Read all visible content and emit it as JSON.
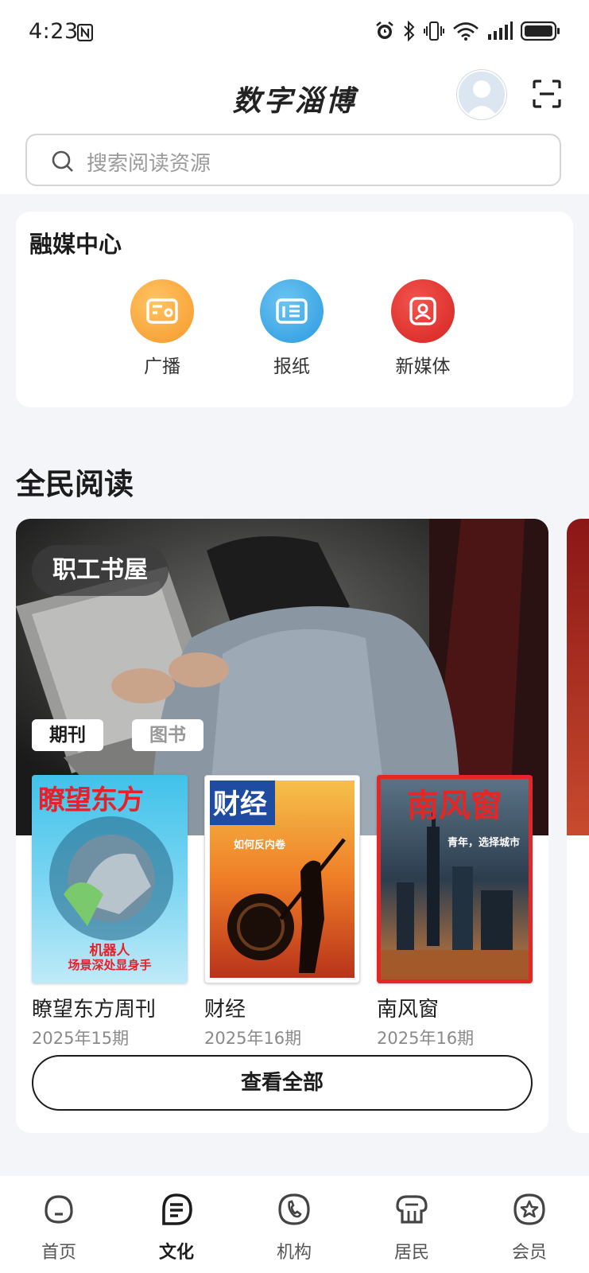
{
  "status_bar": {
    "time": "4:23"
  },
  "header": {
    "app_title": "数字淄博",
    "search_placeholder": "搜索阅读资源"
  },
  "media_center": {
    "title": "融媒中心",
    "items": [
      {
        "label": "广播",
        "icon": "radio-icon",
        "color": "#f9a83a"
      },
      {
        "label": "报纸",
        "icon": "newspaper-icon",
        "color": "#3ea9e8"
      },
      {
        "label": "新媒体",
        "icon": "new-media-icon",
        "color": "#e3342f"
      }
    ]
  },
  "reading": {
    "title": "全民阅读",
    "banner_tag": "职工书屋",
    "tabs": [
      {
        "label": "期刊",
        "active": true
      },
      {
        "label": "图书",
        "active": false
      }
    ],
    "books": [
      {
        "name": "瞭望东方周刊",
        "issue": "2025年15期",
        "cover_title": "瞭望东方",
        "cover_caption_1": "机器人",
        "cover_caption_2": "场景深处显身手"
      },
      {
        "name": "财经",
        "issue": "2025年16期",
        "cover_title": "财经",
        "cover_caption_1": "如何反内卷"
      },
      {
        "name": "南风窗",
        "issue": "2025年16期",
        "cover_title": "南风窗",
        "cover_caption_1": "青年，选择城市"
      }
    ],
    "view_all": "查看全部"
  },
  "tabbar": [
    {
      "label": "首页",
      "icon": "home-icon",
      "active": false
    },
    {
      "label": "文化",
      "icon": "culture-icon",
      "active": true
    },
    {
      "label": "机构",
      "icon": "institution-icon",
      "active": false
    },
    {
      "label": "居民",
      "icon": "resident-icon",
      "active": false
    },
    {
      "label": "会员",
      "icon": "member-icon",
      "active": false
    }
  ]
}
